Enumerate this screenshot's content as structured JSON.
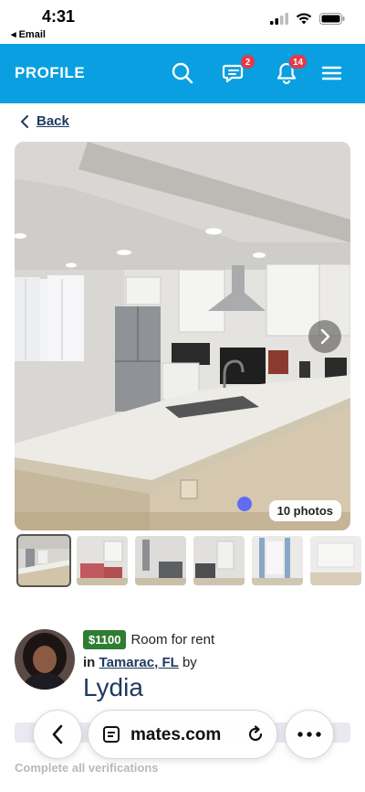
{
  "status_bar": {
    "time": "4:31",
    "back_app": "◂ Email"
  },
  "header": {
    "title": "PROFILE",
    "messages_badge": "2",
    "notifications_badge": "14"
  },
  "back_label": "Back",
  "gallery": {
    "photo_count_label": "10 photos",
    "thumbnail_count": 6
  },
  "listing": {
    "price": "$1100",
    "type": "Room for rent",
    "in_label": "in",
    "location": "Tamarac, FL",
    "by_label": "by",
    "owner": "Lydia"
  },
  "faded": {
    "verification_text": "Complete all verifications"
  },
  "browser_bar": {
    "url_text": "mates.com"
  },
  "colors": {
    "header_bg": "#0a9fe0",
    "badge": "#e63946",
    "price_pill": "#2e7d32",
    "link": "#1e3a5f"
  },
  "icons": [
    "search-icon",
    "chat-icon",
    "bell-icon",
    "menu-icon",
    "chevron-left-icon",
    "chevron-right-icon",
    "reader-icon",
    "reload-icon",
    "more-icon"
  ]
}
